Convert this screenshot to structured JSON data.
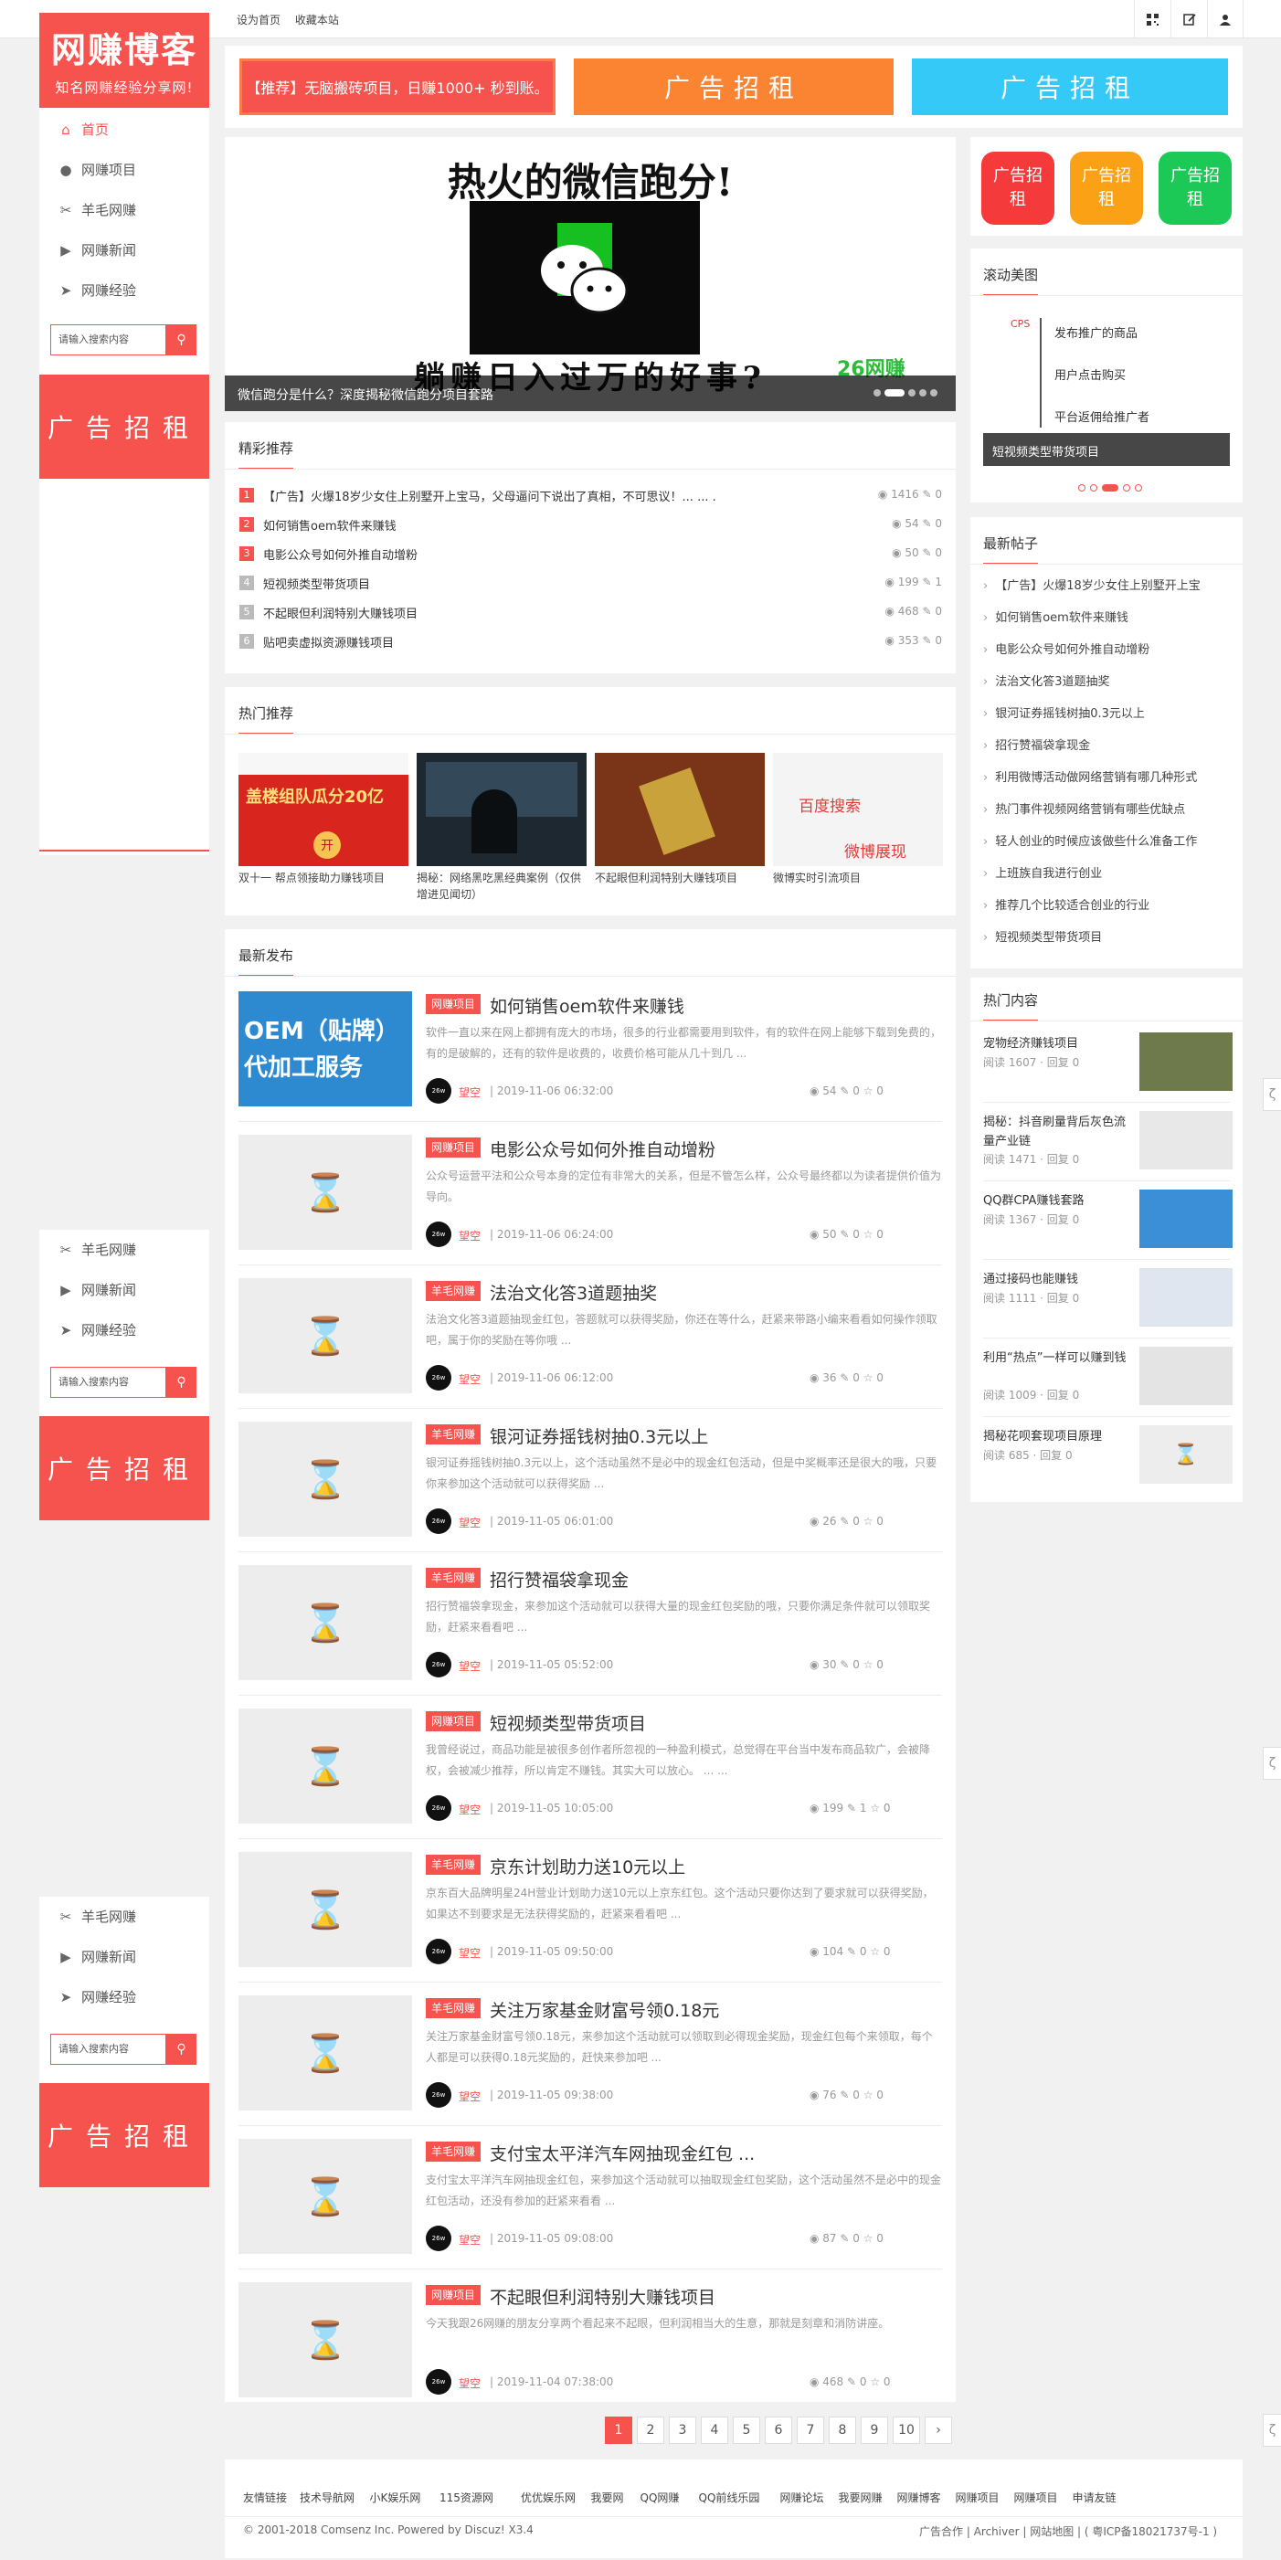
{
  "topbar": {
    "set_home": "设为首页",
    "bookmark": "收藏本站",
    "icons": [
      "qrcode-icon",
      "edit-icon",
      "user-icon"
    ]
  },
  "logo": {
    "title": "网赚博客",
    "tagline": "知名网赚经验分享网!"
  },
  "sidebar": {
    "items": [
      {
        "label": "首页",
        "icon": "home-icon"
      },
      {
        "label": "网赚项目",
        "icon": "chat-icon"
      },
      {
        "label": "羊毛网赚",
        "icon": "scissors-icon"
      },
      {
        "label": "网赚新闻",
        "icon": "video-icon"
      },
      {
        "label": "网赚经验",
        "icon": "send-icon"
      }
    ],
    "repeat_items": [
      "羊毛网赚",
      "网赚新闻",
      "网赚经验"
    ],
    "search_placeholder": "请输入搜索内容",
    "ad_label": "广告招租"
  },
  "top_ads": {
    "promo": "【推荐】无脑搬砖项目，日赚1000+ 秒到账。",
    "ad1": "广告招租",
    "ad2": "广告招租"
  },
  "slider": {
    "headline": "热火的微信跑分!",
    "bottom_text": "躺赚日入过万的好事?",
    "caption": "微信跑分是什么？深度揭秘微信跑分项目套路",
    "watermark": "26网赚"
  },
  "featured": {
    "title": "精彩推荐",
    "items": [
      {
        "rank": "1",
        "text": "【广告】火爆18岁少女住上别墅开上宝马，父母逼问下说出了真相，不可思议！... ... .",
        "views": "1416",
        "comments": "0"
      },
      {
        "rank": "2",
        "text": "如何销售oem软件来赚钱",
        "views": "54",
        "comments": "0"
      },
      {
        "rank": "3",
        "text": "电影公众号如何外推自动增粉",
        "views": "50",
        "comments": "0"
      },
      {
        "rank": "4",
        "text": "短视频类型带货项目",
        "views": "199",
        "comments": "1"
      },
      {
        "rank": "5",
        "text": "不起眼但利润特别大赚钱项目",
        "views": "468",
        "comments": "0"
      },
      {
        "rank": "6",
        "text": "贴吧卖虚拟资源赚钱项目",
        "views": "353",
        "comments": "0"
      }
    ]
  },
  "hot": {
    "title": "热门推荐",
    "items": [
      {
        "caption": "双十一 帮点领接助力赚钱项目",
        "img_text": "盖楼组队瓜分20亿"
      },
      {
        "caption": "揭秘：网络黑吃黑经典案例（仅供增进见闻切）",
        "img_text": ""
      },
      {
        "caption": "不起眼但利润特别大赚钱项目",
        "img_text": ""
      },
      {
        "caption": "微博实时引流项目",
        "img_text": "百度搜索 / 微博展现"
      }
    ]
  },
  "latest": {
    "title": "最新发布",
    "author": "望空",
    "posts": [
      {
        "tag": "网赚项目",
        "title": "如何销售oem软件来赚钱",
        "desc": "软件一直以来在网上都拥有庞大的市场，很多的行业都需要用到软件，有的软件在网上能够下载到免费的，有的是破解的，还有的软件是收费的，收费价格可能从几十到几 ...",
        "date": "2019-11-06 06:32:00",
        "views": "54",
        "comments": "0",
        "likes": "0",
        "thumb": "OEM（贴牌）代加工服务"
      },
      {
        "tag": "网赚项目",
        "title": "电影公众号如何外推自动增粉",
        "desc": "公众号运营平法和公众号本身的定位有非常大的关系，但是不管怎么样，公众号最终都以为读者提供价值为导向。",
        "date": "2019-11-06 06:24:00",
        "views": "50",
        "comments": "0",
        "likes": "0",
        "thumb": ""
      },
      {
        "tag": "羊毛网赚",
        "title": "法治文化答3道题抽奖",
        "desc": "法治文化答3道题抽现金红包，答题就可以获得奖励，你还在等什么，赶紧来带路小编来看看如何操作领取吧，属于你的奖励在等你哦 ...",
        "date": "2019-11-06 06:12:00",
        "views": "36",
        "comments": "0",
        "likes": "0",
        "thumb": ""
      },
      {
        "tag": "羊毛网赚",
        "title": "银河证券摇钱树抽0.3元以上",
        "desc": "银河证券摇钱树抽0.3元以上，这个活动虽然不是必中的现金红包活动，但是中奖概率还是很大的哦，只要你来参加这个活动就可以获得奖励 ...",
        "date": "2019-11-05 06:01:00",
        "views": "26",
        "comments": "0",
        "likes": "0",
        "thumb": ""
      },
      {
        "tag": "羊毛网赚",
        "title": "招行赞福袋拿现金",
        "desc": "招行赞福袋拿现金，来参加这个活动就可以获得大量的现金红包奖励的哦，只要你满足条件就可以领取奖励，赶紧来看看吧 ...",
        "date": "2019-11-05 05:52:00",
        "views": "30",
        "comments": "0",
        "likes": "0",
        "thumb": ""
      },
      {
        "tag": "网赚项目",
        "title": "短视频类型带货项目",
        "desc": "我曾经说过，商品功能是被很多创作者所忽视的一种盈利模式，总觉得在平台当中发布商品软广，会被降权，会被减少推荐，所以肯定不赚钱。其实大可以放心。 ... ...",
        "date": "2019-11-05 10:05:00",
        "views": "199",
        "comments": "1",
        "likes": "0",
        "thumb": ""
      },
      {
        "tag": "羊毛网赚",
        "title": "京东计划助力送10元以上",
        "desc": "京东百大品牌明星24H营业计划助力送10元以上京东红包。这个活动只要你达到了要求就可以获得奖励，如果达不到要求是无法获得奖励的，赶紧来看看吧 ...",
        "date": "2019-11-05 09:50:00",
        "views": "104",
        "comments": "0",
        "likes": "0",
        "thumb": ""
      },
      {
        "tag": "羊毛网赚",
        "title": "关注万家基金财富号领0.18元",
        "desc": "关注万家基金财富号领0.18元，来参加这个活动就可以领取到必得现金奖励，现金红包每个来领取，每个人都是可以获得0.18元奖励的，赶快来参加吧 ...",
        "date": "2019-11-05 09:38:00",
        "views": "76",
        "comments": "0",
        "likes": "0",
        "thumb": ""
      },
      {
        "tag": "羊毛网赚",
        "title": "支付宝太平洋汽车网抽现金红包 ...",
        "desc": "支付宝太平洋汽车网抽现金红包，来参加这个活动就可以抽取现金红包奖励，这个活动虽然不是必中的现金红包活动，还没有参加的赶紧来看看 ...",
        "date": "2019-11-05 09:08:00",
        "views": "87",
        "comments": "0",
        "likes": "0",
        "thumb": ""
      },
      {
        "tag": "网赚项目",
        "title": "不起眼但利润特别大赚钱项目",
        "desc": "今天我跟26网赚的朋友分享两个看起来不起眼，但利润相当大的生意，那就是刻章和消防讲座。",
        "date": "2019-11-04 07:38:00",
        "views": "468",
        "comments": "0",
        "likes": "0",
        "thumb": ""
      }
    ]
  },
  "pagination": [
    "1",
    "2",
    "3",
    "4",
    "5",
    "6",
    "7",
    "8",
    "9",
    "10",
    "›"
  ],
  "right": {
    "icon_ads": [
      "广告招租",
      "广告招租",
      "广告招租"
    ],
    "scroll_title": "滚动美图",
    "scroll_caption": "短视频类型带货项目",
    "scroll_lines": [
      "发布推广的商品",
      "用户点击购买",
      "平台返佣给推广者"
    ],
    "recent_title": "最新帖子",
    "recent": [
      "【广告】火爆18岁少女住上别墅开上宝",
      "如何销售oem软件来赚钱",
      "电影公众号如何外推自动增粉",
      "法治文化答3道题抽奖",
      "银河证券摇钱树抽0.3元以上",
      "招行赞福袋拿现金",
      "利用微博活动做网络营销有哪几种形式",
      "热门事件视频网络营销有哪些优缺点",
      "轻人创业的时候应该做些什么准备工作",
      "上班族自我进行创业",
      "推荐几个比较适合创业的行业",
      "短视频类型带货项目"
    ],
    "hot_title": "热门内容",
    "hot": [
      {
        "title": "宠物经济赚钱项目",
        "meta": "阅读 1607 · 回复 0"
      },
      {
        "title": "揭秘：抖音刷量背后灰色流量产业链",
        "meta": "阅读 1471 · 回复 0"
      },
      {
        "title": "QQ群CPA赚钱套路",
        "meta": "阅读 1367 · 回复 0"
      },
      {
        "title": "通过接码也能赚钱",
        "meta": "阅读 1111 · 回复 0"
      },
      {
        "title": "利用“热点”一样可以赚到钱",
        "meta": "阅读 1009 · 回复 0"
      },
      {
        "title": "揭秘花呗套现项目原理",
        "meta": "阅读 685 · 回复 0"
      }
    ]
  },
  "footer": {
    "links_label": "友情链接",
    "links": [
      "技术导航网",
      "小K娱乐网",
      "115资源网",
      "优优娱乐网",
      "我要网",
      "QQ网赚",
      "QQ前线乐园",
      "网赚论坛",
      "我要网赚",
      "网赚博客",
      "网赚项目",
      "网赚项目",
      "申请友链"
    ],
    "copyright": "© 2001-2018 Comsenz Inc. Powered by Discuz! X3.4",
    "right_links": [
      "广告合作",
      "Archiver",
      "网站地图",
      "( 粤ICP备18021737号-1 )"
    ]
  },
  "colors": {
    "accent": "#f6534e",
    "orange": "#fb8433",
    "blue": "#35c9f7",
    "green": "#1cc956"
  }
}
